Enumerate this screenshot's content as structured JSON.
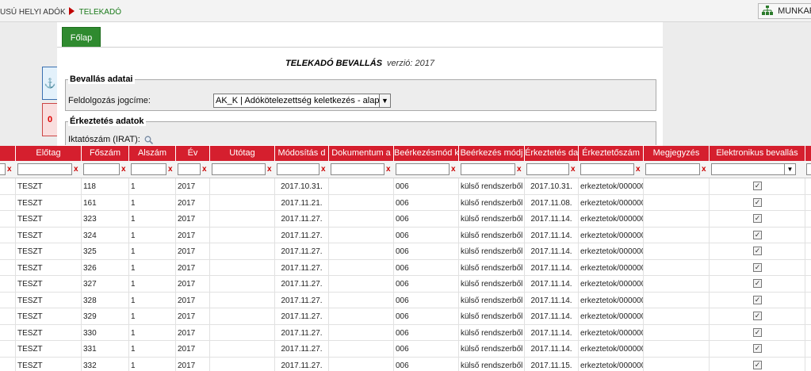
{
  "breadcrumb": {
    "parent": "USÚ HELYI ADÓK",
    "current": "TELEKADÓ"
  },
  "munka_button": {
    "label": "MUNKAF"
  },
  "tabs": [
    {
      "label": "Főlap"
    }
  ],
  "form_title": {
    "title": "TELEKADÓ BEVALLÁS",
    "version": "verzió: 2017"
  },
  "side_tabs": {
    "blue_icon": "anchor-icon",
    "red_count": "0"
  },
  "bevallas": {
    "legend": "Bevallás adatai",
    "jogcim_label": "Feldolgozás jogcíme:",
    "jogcim_value": "AK_K | Adókötelezettség keletkezés - alap"
  },
  "erkeztetes": {
    "legend": "Érkeztetés adatok",
    "iktatoszam_label": "Iktatószám (IRAT):"
  },
  "grid": {
    "columns": [
      "Előtag",
      "Főszám",
      "Alszám",
      "Év",
      "Utótag",
      "Módosítás d",
      "Dokumentum a",
      "Beérkezésmód k",
      "Beérkezés módj",
      "Érkeztetés da",
      "Érkeztetőszám",
      "Megjegyzés",
      "Elektronikus bevallás"
    ],
    "rows": [
      {
        "elotag": "TESZT",
        "foszam": "118",
        "alszam": "1",
        "ev": "2017",
        "mod": "2017.10.31.",
        "bmod": "006",
        "bmodj": "külső rendszerből",
        "erk": "2017.10.31.",
        "erksz": "erkeztetok/000000"
      },
      {
        "elotag": "TESZT",
        "foszam": "161",
        "alszam": "1",
        "ev": "2017",
        "mod": "2017.11.21.",
        "bmod": "006",
        "bmodj": "külső rendszerből",
        "erk": "2017.11.08.",
        "erksz": "erkeztetok/000000"
      },
      {
        "elotag": "TESZT",
        "foszam": "323",
        "alszam": "1",
        "ev": "2017",
        "mod": "2017.11.27.",
        "bmod": "006",
        "bmodj": "külső rendszerből",
        "erk": "2017.11.14.",
        "erksz": "erkeztetok/000000"
      },
      {
        "elotag": "TESZT",
        "foszam": "324",
        "alszam": "1",
        "ev": "2017",
        "mod": "2017.11.27.",
        "bmod": "006",
        "bmodj": "külső rendszerből",
        "erk": "2017.11.14.",
        "erksz": "erkeztetok/000000"
      },
      {
        "elotag": "TESZT",
        "foszam": "325",
        "alszam": "1",
        "ev": "2017",
        "mod": "2017.11.27.",
        "bmod": "006",
        "bmodj": "külső rendszerből",
        "erk": "2017.11.14.",
        "erksz": "erkeztetok/000000"
      },
      {
        "elotag": "TESZT",
        "foszam": "326",
        "alszam": "1",
        "ev": "2017",
        "mod": "2017.11.27.",
        "bmod": "006",
        "bmodj": "külső rendszerből",
        "erk": "2017.11.14.",
        "erksz": "erkeztetok/000000"
      },
      {
        "elotag": "TESZT",
        "foszam": "327",
        "alszam": "1",
        "ev": "2017",
        "mod": "2017.11.27.",
        "bmod": "006",
        "bmodj": "külső rendszerből",
        "erk": "2017.11.14.",
        "erksz": "erkeztetok/000000"
      },
      {
        "elotag": "TESZT",
        "foszam": "328",
        "alszam": "1",
        "ev": "2017",
        "mod": "2017.11.27.",
        "bmod": "006",
        "bmodj": "külső rendszerből",
        "erk": "2017.11.14.",
        "erksz": "erkeztetok/000000"
      },
      {
        "elotag": "TESZT",
        "foszam": "329",
        "alszam": "1",
        "ev": "2017",
        "mod": "2017.11.27.",
        "bmod": "006",
        "bmodj": "külső rendszerből",
        "erk": "2017.11.14.",
        "erksz": "erkeztetok/000000"
      },
      {
        "elotag": "TESZT",
        "foszam": "330",
        "alszam": "1",
        "ev": "2017",
        "mod": "2017.11.27.",
        "bmod": "006",
        "bmodj": "külső rendszerből",
        "erk": "2017.11.14.",
        "erksz": "erkeztetok/000000"
      },
      {
        "elotag": "TESZT",
        "foszam": "331",
        "alszam": "1",
        "ev": "2017",
        "mod": "2017.11.27.",
        "bmod": "006",
        "bmodj": "külső rendszerből",
        "erk": "2017.11.14.",
        "erksz": "erkeztetok/000000"
      },
      {
        "elotag": "TESZT",
        "foszam": "332",
        "alszam": "1",
        "ev": "2017",
        "mod": "2017.11.27.",
        "bmod": "006",
        "bmodj": "külső rendszerből",
        "erk": "2017.11.15.",
        "erksz": "erkeztetok/000000"
      }
    ],
    "filter_clear_symbol": "x",
    "checked_symbol": "✓",
    "header_color": "#d51f2e"
  }
}
